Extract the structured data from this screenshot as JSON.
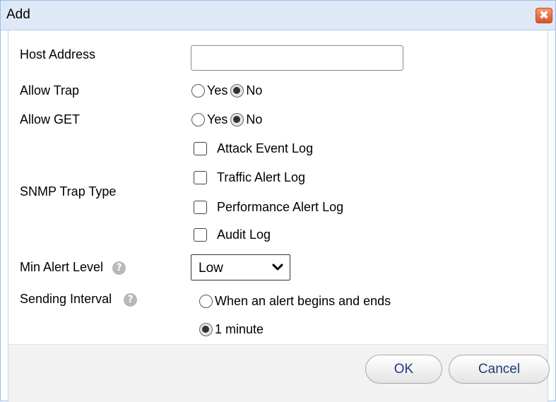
{
  "dialog": {
    "title": "Add",
    "close_glyph": "✖"
  },
  "form": {
    "host_address": {
      "label": "Host Address",
      "value": "",
      "placeholder": ""
    },
    "allow_trap": {
      "label": "Allow Trap",
      "options": [
        "Yes",
        "No"
      ],
      "selected": "No"
    },
    "allow_get": {
      "label": "Allow GET",
      "options": [
        "Yes",
        "No"
      ],
      "selected": "No"
    },
    "snmp_trap_type": {
      "label": "SNMP Trap Type",
      "options": [
        {
          "label": "Attack Event Log",
          "checked": false
        },
        {
          "label": "Traffic Alert Log",
          "checked": false
        },
        {
          "label": "Performance Alert Log",
          "checked": false
        },
        {
          "label": "Audit Log",
          "checked": false
        }
      ]
    },
    "min_alert_level": {
      "label": "Min Alert Level",
      "value": "Low",
      "help_icon": "help-icon"
    },
    "sending_interval": {
      "label": "Sending Interval",
      "help_icon": "help-icon",
      "options": [
        "When an alert begins and ends",
        "1 minute"
      ],
      "selected": "1 minute"
    }
  },
  "footer": {
    "ok_label": "OK",
    "cancel_label": "Cancel"
  },
  "colors": {
    "titlebar": "#dfe8f6",
    "close_button": "#e0653a",
    "footer": "#f2f2f2",
    "button_text": "#1d3c7a"
  }
}
